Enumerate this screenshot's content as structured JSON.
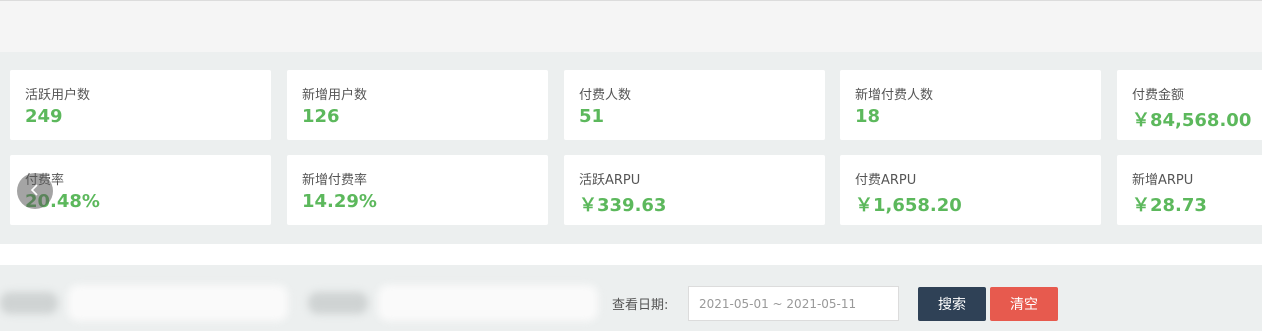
{
  "stats": {
    "row1": [
      {
        "label": "活跃用户数",
        "value": "249"
      },
      {
        "label": "新增用户数",
        "value": "126"
      },
      {
        "label": "付费人数",
        "value": "51"
      },
      {
        "label": "新增付费人数",
        "value": "18"
      },
      {
        "label": "付费金额",
        "value": "￥84,568.00"
      }
    ],
    "row2": [
      {
        "label": "付费率",
        "value": "20.48%"
      },
      {
        "label": "新增付费率",
        "value": "14.29%"
      },
      {
        "label": "活跃ARPU",
        "value": "￥339.63"
      },
      {
        "label": "付费ARPU",
        "value": "￥1,658.20"
      },
      {
        "label": "新增ARPU",
        "value": "￥28.73"
      }
    ]
  },
  "carousel": {
    "prev_icon": "chevron-left-icon"
  },
  "filters": {
    "date_label": "查看日期:",
    "date_range": "2021-05-01 ~ 2021-05-11"
  },
  "buttons": {
    "search": "搜索",
    "clear": "清空"
  },
  "colors": {
    "value_green": "#5cb85c",
    "search_button": "#2f4156",
    "clear_button": "#e75a4e"
  }
}
